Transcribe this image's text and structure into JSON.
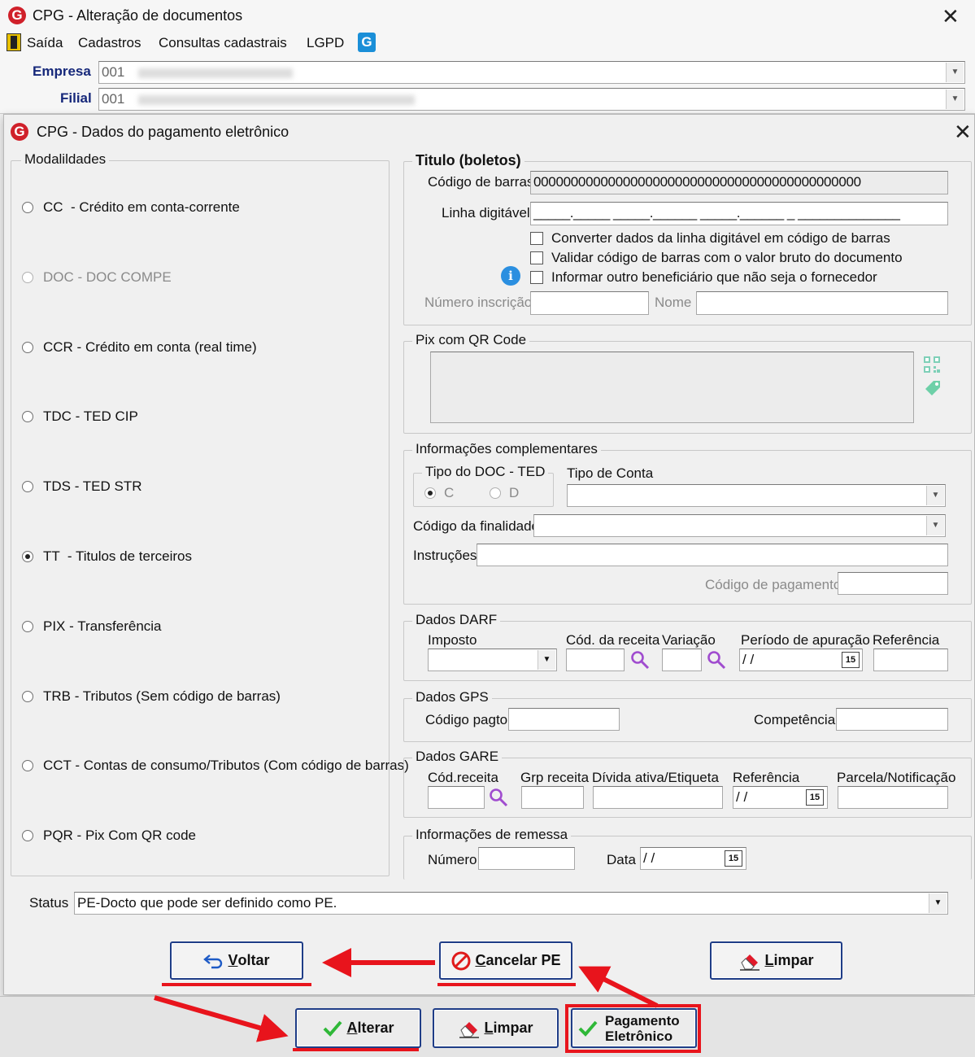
{
  "main_window": {
    "title": "CPG - Alteração de documentos",
    "menu": [
      "Saída",
      "Cadastros",
      "Consultas cadastrais",
      "LGPD"
    ],
    "empresa_label": "Empresa",
    "empresa_value": "001",
    "filial_label": "Filial",
    "filial_value": "001"
  },
  "dialog": {
    "title": "CPG - Dados do pagamento eletrônico",
    "modalidades": {
      "legend": "Modalildades",
      "options": [
        {
          "label": "CC  - Crédito em conta-corrente",
          "selected": false,
          "enabled": true
        },
        {
          "label": "DOC - DOC COMPE",
          "selected": false,
          "enabled": false
        },
        {
          "label": "CCR - Crédito em conta (real time)",
          "selected": false,
          "enabled": true
        },
        {
          "label": "TDC - TED CIP",
          "selected": false,
          "enabled": true
        },
        {
          "label": "TDS - TED STR",
          "selected": false,
          "enabled": true
        },
        {
          "label": "TT  - Titulos de terceiros",
          "selected": true,
          "enabled": true
        },
        {
          "label": "PIX - Transferência",
          "selected": false,
          "enabled": true
        },
        {
          "label": "TRB - Tributos (Sem código de barras)",
          "selected": false,
          "enabled": true
        },
        {
          "label": "CCT - Contas de consumo/Tributos (Com código de barras)",
          "selected": false,
          "enabled": true
        },
        {
          "label": "PQR - Pix Com QR code",
          "selected": false,
          "enabled": true
        }
      ]
    },
    "titulo": {
      "legend": "Titulo (boletos)",
      "codigo_barras_label": "Código de barras",
      "codigo_barras_value": "00000000000000000000000000000000000000000000",
      "linha_digitavel_label": "Linha digitável",
      "linha_digitavel_value": "_____._____ _____.______ _____.______ _ ______________",
      "check_converter": "Converter dados da linha digitável em código de barras",
      "check_validar": "Validar código de barras com o valor bruto do documento",
      "check_informar": "Informar outro beneficiário que não seja o fornecedor",
      "numero_inscricao_label": "Número inscrição",
      "nome_label": "Nome"
    },
    "pix": {
      "legend": "Pix com QR Code"
    },
    "info_comp": {
      "legend": "Informações complementares",
      "tipo_doc_legend": "Tipo do DOC - TED",
      "opt_c": "C",
      "opt_d": "D",
      "tipo_conta_label": "Tipo de Conta",
      "codigo_finalidade_label": "Código da finalidade",
      "instrucoes_label": "Instruções",
      "codigo_pagamento_label": "Código de pagamento"
    },
    "darf": {
      "legend": "Dados DARF",
      "imposto_label": "Imposto",
      "cod_receita_label": "Cód. da receita",
      "variacao_label": "Variação",
      "periodo_label": "Período de apuração",
      "periodo_value": " / /",
      "referencia_label": "Referência"
    },
    "gps": {
      "legend": "Dados GPS",
      "codigo_pagto_label": "Código pagto",
      "competencia_label": "Competência"
    },
    "gare": {
      "legend": "Dados GARE",
      "cod_receita_label": "Cód.receita",
      "grp_receita_label": "Grp receita",
      "divida_label": "Dívida ativa/Etiqueta",
      "referencia_label": "Referência",
      "referencia_value": " / /",
      "parcela_label": "Parcela/Notificação"
    },
    "remessa": {
      "legend": "Informações de remessa",
      "numero_label": "Número",
      "data_label": "Data",
      "data_value": " / /"
    },
    "status_label": "Status",
    "status_value": "PE-Docto  que pode ser definido como PE.",
    "buttons": {
      "voltar_u": "V",
      "voltar_rest": "oltar",
      "cancelar_u": "C",
      "cancelar_rest": "ancelar PE",
      "limpar_u": "L",
      "limpar_rest": "impar"
    },
    "calendar_icon_text": "15"
  },
  "bottom_buttons": {
    "alterar_u": "A",
    "alterar_rest": "lterar",
    "limpar_u": "L",
    "limpar_rest": "impar",
    "pagamento_line1": "Pagamento",
    "pagamento_line2": "Eletrônico"
  },
  "colors": {
    "annotation_red": "#e8141c",
    "button_border": "#1f3d87",
    "logo_red": "#d0202a"
  }
}
